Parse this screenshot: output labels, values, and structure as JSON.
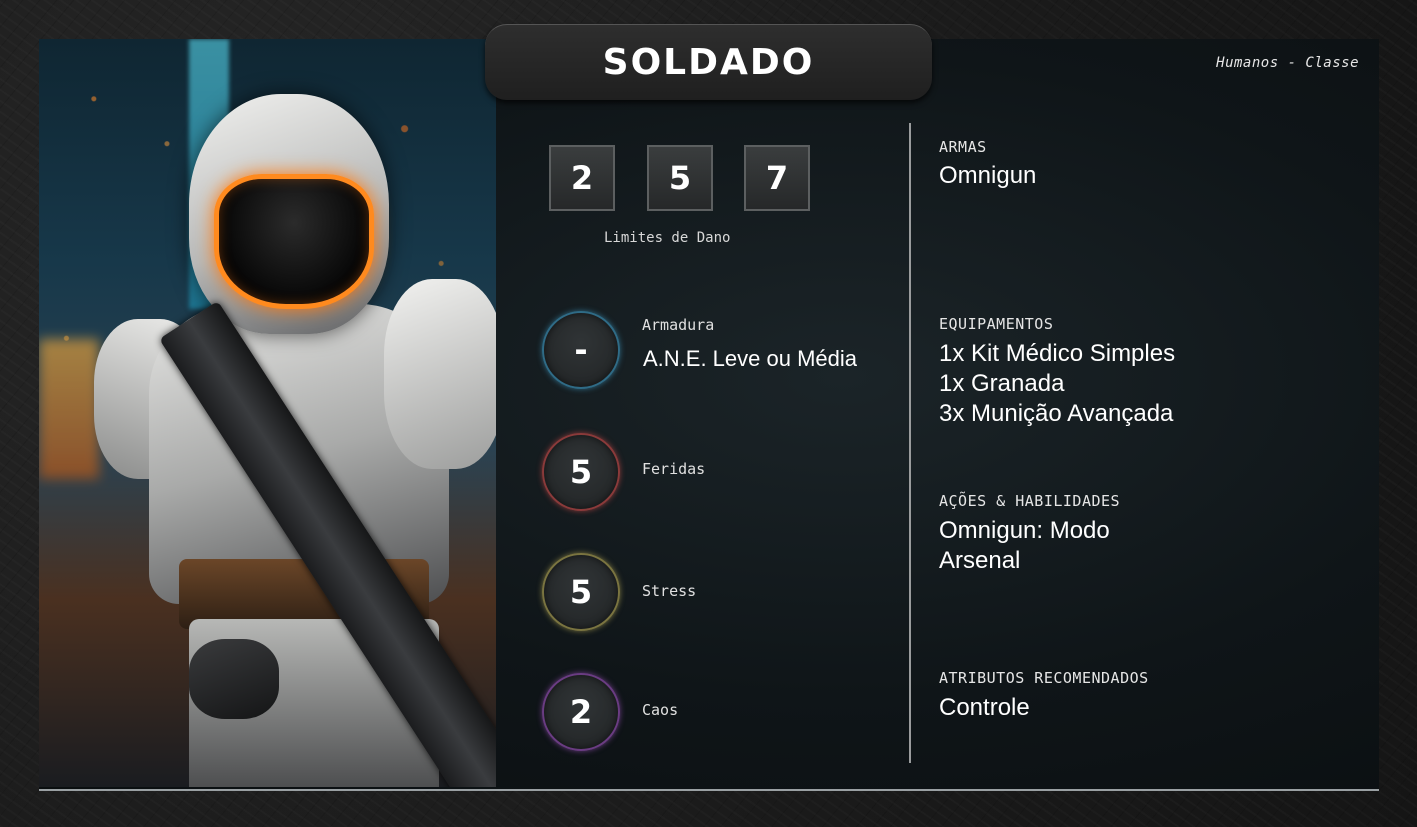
{
  "card": {
    "title": "SOLDADO",
    "subtitle": "Humanos - Classe"
  },
  "damage_limits": {
    "values": [
      "2",
      "5",
      "7"
    ],
    "label": "Limites de Dano"
  },
  "stats": {
    "armor": {
      "value": "-",
      "label": "Armadura",
      "detail": "A.N.E. Leve ou Média",
      "ring_color": "#2f6b86"
    },
    "wounds": {
      "value": "5",
      "label": "Feridas",
      "ring_color": "#8a3a3a"
    },
    "stress": {
      "value": "5",
      "label": "Stress",
      "ring_color": "#7a7440"
    },
    "chaos": {
      "value": "2",
      "label": "Caos",
      "ring_color": "#6a3c82"
    }
  },
  "sections": {
    "weapons": {
      "label": "ARMAS",
      "items": [
        "Omnigun"
      ]
    },
    "equipment": {
      "label": "EQUIPAMENTOS",
      "items": [
        "1x Kit Médico Simples",
        "1x Granada",
        "3x Munição Avançada"
      ]
    },
    "actions": {
      "label": "AÇÕES & HABILIDADES",
      "items": [
        "Omnigun: Modo",
        "Arsenal"
      ]
    },
    "attributes": {
      "label": "ATRIBUTOS RECOMENDADOS",
      "items": [
        "Controle"
      ]
    }
  },
  "portrait": {
    "icon": "armored-soldier-portrait"
  }
}
